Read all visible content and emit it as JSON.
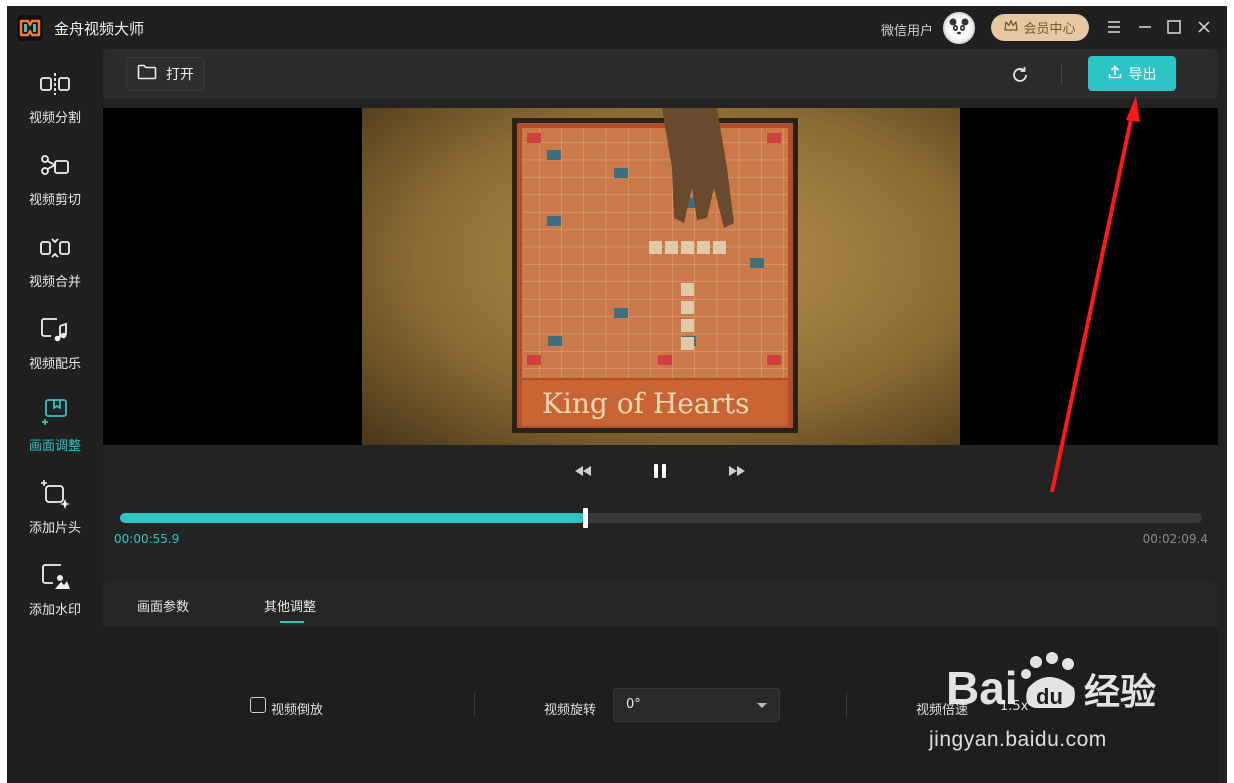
{
  "app": {
    "title": "金舟视频大师"
  },
  "user": {
    "name": "微信用户",
    "vip_label": "会员中心"
  },
  "sidebar": {
    "items": [
      {
        "label": "视频分割",
        "icon": "split-icon"
      },
      {
        "label": "视频剪切",
        "icon": "scissors-icon"
      },
      {
        "label": "视频合并",
        "icon": "merge-icon"
      },
      {
        "label": "视频配乐",
        "icon": "music-icon"
      },
      {
        "label": "画面调整",
        "icon": "frame-adjust-icon",
        "active": true
      },
      {
        "label": "添加片头",
        "icon": "add-intro-icon"
      },
      {
        "label": "添加水印",
        "icon": "watermark-icon"
      }
    ]
  },
  "toolbar": {
    "open_label": "打开",
    "export_label": "导出"
  },
  "player": {
    "current_time": "00:00:55.9",
    "total_time": "00:02:09.4",
    "progress": 0.43
  },
  "panel": {
    "tabs": [
      {
        "label": "画面参数"
      },
      {
        "label": "其他调整",
        "active": true
      }
    ],
    "reverse_label": "视频倒放",
    "rotate_label": "视频旋转",
    "rotate_value": "0°",
    "speed_label": "视频倍速",
    "speed_value": "1.5x"
  },
  "watermark": {
    "brand": "Baidu经验",
    "url": "jingyan.baidu.com"
  },
  "colors": {
    "accent": "#2ec4c4",
    "vip": "#e8c8a4",
    "arrow": "#ff1a1a"
  }
}
